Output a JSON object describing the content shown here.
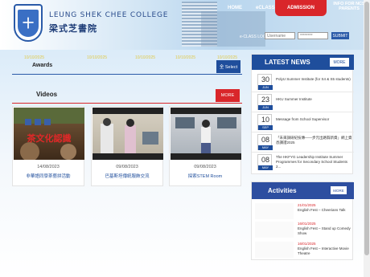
{
  "header": {
    "school_name_en": "LEUNG SHEK CHEE COLLEGE",
    "school_name_zh": "梁式芝書院",
    "crest_glyph": "十",
    "nav": [
      "HOME",
      "eCLASS",
      "ADMISSION"
    ],
    "info_link": "INFO FOR NCS PARENTS",
    "login_label": "e-CLASS LOGIN",
    "username_placeholder": "Username",
    "password_placeholder": "********",
    "submit_label": "SUBMIT"
  },
  "awards_strip": {
    "label": "Awards",
    "dates": [
      "10/10/2025",
      "10/10/2025",
      "10/10/2025",
      "10/10/2025",
      "10/10/2025"
    ],
    "button_label": "全 Select"
  },
  "videos": {
    "title": "Videos",
    "more_label": "MORE",
    "items": [
      {
        "date": "14/08/2023",
        "title": "非華語同學茶藝拼活動",
        "thumb_text": "茶文化認識"
      },
      {
        "date": "09/08/2023",
        "title": "巴基斯坦傳統服飾交流",
        "thumb_text": ""
      },
      {
        "date": "09/08/2023",
        "title": "探索STEM Room",
        "thumb_text": ""
      }
    ]
  },
  "latest_news": {
    "title": "LATEST NEWS",
    "more_label": "MORE",
    "items": [
      {
        "day": "30",
        "month": "JUN",
        "text": "PolyU Summer Institute (for S4 & S5 students)"
      },
      {
        "day": "23",
        "month": "JUN",
        "text": "HKU Summer Institute"
      },
      {
        "day": "10",
        "month": "SEP",
        "text": "Message from School Supervisor"
      },
      {
        "day": "08",
        "month": "MAY",
        "text": "「未來調研紀技傳——步元出路翦新資」網上資悉講證2025"
      },
      {
        "day": "08",
        "month": "MAY",
        "text": "The HKFYG Leadership Institute Summer Programmes for Secondary School Students 2..."
      }
    ]
  },
  "activities": {
    "title": "Activities",
    "more_label": "MORE",
    "items": [
      {
        "date": "21/01/2025",
        "text": "English Fest – Cheerians Talk"
      },
      {
        "date": "16/01/2025",
        "text": "English Fest – Stand up Comedy Show"
      },
      {
        "date": "16/01/2025",
        "text": "English Fest – Interactive Movie Theatre"
      }
    ]
  },
  "colors": {
    "brand_blue": "#1f4e9c",
    "accent_red": "#d9262a"
  }
}
